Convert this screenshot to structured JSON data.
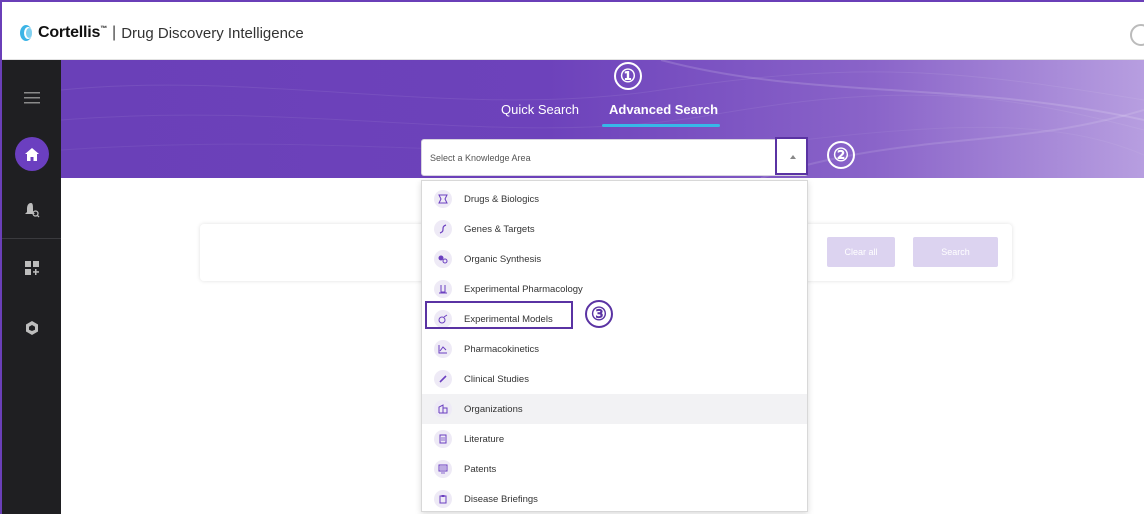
{
  "brand": {
    "name": "Cortellis",
    "trademark": "™",
    "separator": "|",
    "product": "Drug Discovery Intelligence"
  },
  "tabs": [
    {
      "label": "Quick Search",
      "active": false
    },
    {
      "label": "Advanced Search",
      "active": true
    }
  ],
  "callouts": {
    "one": "①",
    "two": "②",
    "three": "③"
  },
  "knowledge_area": {
    "placeholder": "Select a Knowledge Area"
  },
  "actions": {
    "clear_label": "Clear all",
    "search_label": "Search"
  },
  "dropdown": {
    "items": [
      {
        "label": "Drugs & Biologics",
        "icon": "pill-icon"
      },
      {
        "label": "Genes & Targets",
        "icon": "dna-icon"
      },
      {
        "label": "Organic Synthesis",
        "icon": "molecule-icon"
      },
      {
        "label": "Experimental Pharmacology",
        "icon": "flask-icon"
      },
      {
        "label": "Experimental Models",
        "icon": "model-icon"
      },
      {
        "label": "Pharmacokinetics",
        "icon": "chart-icon"
      },
      {
        "label": "Clinical Studies",
        "icon": "syringe-icon"
      },
      {
        "label": "Organizations",
        "icon": "building-icon"
      },
      {
        "label": "Literature",
        "icon": "book-icon"
      },
      {
        "label": "Patents",
        "icon": "patent-icon"
      },
      {
        "label": "Disease Briefings",
        "icon": "clipboard-icon"
      }
    ]
  },
  "colors": {
    "accent": "#6b3fc0",
    "highlight": "#5a33a3",
    "tab_underline": "#37b8e8",
    "nav_bg": "#1f1f22"
  }
}
